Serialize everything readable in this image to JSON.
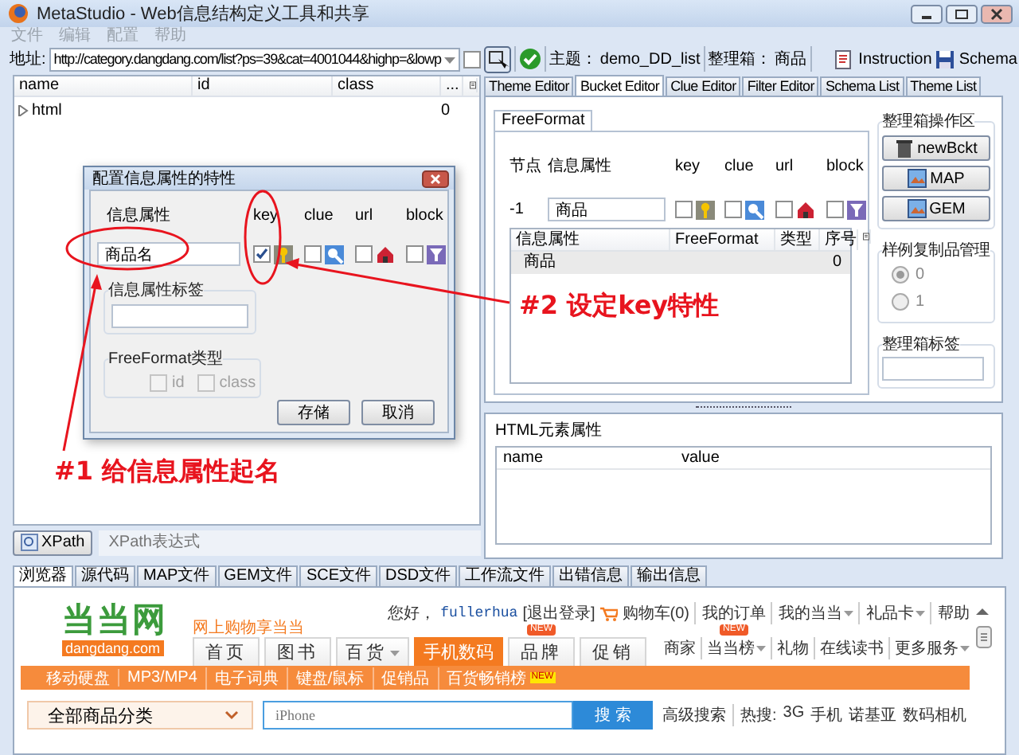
{
  "window": {
    "title": "MetaStudio - Web信息结构定义工具和共享"
  },
  "menu": [
    "文件",
    "编辑",
    "配置",
    "帮助"
  ],
  "toolbar": {
    "address_label": "地址:",
    "url": "http://category.dangdang.com/list?ps=39&cat=4001044&highp=&lowp",
    "checked": false,
    "theme_label": "主题：",
    "theme": "demo_DD_list",
    "bucket_label": "整理箱：",
    "bucket": "商品",
    "buttons": [
      "Instruction",
      "Schema"
    ]
  },
  "dom_tree": {
    "columns": [
      "name",
      "id",
      "class",
      "..."
    ],
    "rows": [
      {
        "name": "html",
        "value": "0",
        "expanded": false
      }
    ]
  },
  "xpath": {
    "button": "XPath",
    "placeholder": "XPath表达式"
  },
  "dialog": {
    "title": "配置信息属性的特性",
    "headers": [
      "信息属性",
      "key",
      "clue",
      "url",
      "block"
    ],
    "attribute": "商品名",
    "flags": [
      {
        "kind": "key",
        "checked": true
      },
      {
        "kind": "clue",
        "checked": false
      },
      {
        "kind": "url",
        "checked": false
      },
      {
        "kind": "block",
        "checked": false
      }
    ],
    "label_group": {
      "title": "信息属性标签"
    },
    "freeformat_group": {
      "title": "FreeFormat类型",
      "disabled": true,
      "options": [
        {
          "label": "id",
          "checked": false
        },
        {
          "label": "class",
          "checked": false
        }
      ]
    },
    "buttons": [
      "存储",
      "取消"
    ]
  },
  "editor_tabs": [
    {
      "label": "Theme Editor",
      "selected": false
    },
    {
      "label": "Bucket Editor",
      "selected": true
    },
    {
      "label": "Clue Editor",
      "selected": false
    },
    {
      "label": "Filter Editor",
      "selected": false
    },
    {
      "label": "Schema List",
      "selected": false
    },
    {
      "label": "Theme List",
      "selected": false
    }
  ],
  "bucket_editor": {
    "subtab": "FreeFormat",
    "headers": [
      "节点",
      "信息属性",
      "key",
      "clue",
      "url",
      "block"
    ],
    "node": "-1",
    "attribute": "商品",
    "flags": [
      {
        "kind": "key",
        "checked": false
      },
      {
        "kind": "clue",
        "checked": false
      },
      {
        "kind": "url",
        "checked": false
      },
      {
        "kind": "block",
        "checked": false
      }
    ],
    "table": {
      "columns": [
        "信息属性",
        "FreeFormat",
        "类型",
        "序号"
      ],
      "rows": [
        {
          "attribute": "商品",
          "index": "0",
          "selected": true
        }
      ]
    }
  },
  "bucket_ops": {
    "title": "整理箱操作区",
    "buttons": [
      "newBckt",
      "MAP",
      "GEM"
    ]
  },
  "sample_mgmt": {
    "title": "样例复制品管理",
    "options": [
      {
        "label": "0",
        "selected": true
      },
      {
        "label": "1",
        "selected": false
      }
    ]
  },
  "bucket_tag": {
    "title": "整理箱标签"
  },
  "html_attributes": {
    "title": "HTML元素属性",
    "columns": [
      "name",
      "value"
    ]
  },
  "bottom_tabs": [
    {
      "label": "浏览器",
      "selected": true
    },
    {
      "label": "源代码",
      "selected": false
    },
    {
      "label": "MAP文件",
      "selected": false
    },
    {
      "label": "GEM文件",
      "selected": false
    },
    {
      "label": "SCE文件",
      "selected": false
    },
    {
      "label": "DSD文件",
      "selected": false
    },
    {
      "label": "工作流文件",
      "selected": false
    },
    {
      "label": "出错信息",
      "selected": false
    },
    {
      "label": "输出信息",
      "selected": false
    }
  ],
  "web_page": {
    "logo": "当当网",
    "logo_sub": "dangdang.com",
    "slogan": "网上购物享当当",
    "greeting": "您好，",
    "user": "fullerhua",
    "logout": "[退出登录]",
    "cart": "购物车(0)",
    "links": [
      {
        "label": "我的订单",
        "dropdown": false
      },
      {
        "label": "我的当当",
        "dropdown": true
      },
      {
        "label": "礼品卡",
        "dropdown": true
      },
      {
        "label": "帮助",
        "dropdown": false
      }
    ],
    "nav": [
      {
        "label": "首页",
        "selected": false,
        "dropdown": false
      },
      {
        "label": "图书",
        "selected": false,
        "dropdown": false
      },
      {
        "label": "百货",
        "selected": false,
        "dropdown": true
      },
      {
        "label": "手机数码",
        "selected": true,
        "dropdown": false
      },
      {
        "label": "品牌",
        "selected": false,
        "dropdown": false,
        "badge": "NEW"
      },
      {
        "label": "促销",
        "selected": false,
        "dropdown": false
      }
    ],
    "nav_right": [
      {
        "label": "商家",
        "dropdown": false
      },
      {
        "label": "当当榜",
        "dropdown": true,
        "badge": "NEW"
      },
      {
        "label": "礼物",
        "dropdown": false
      },
      {
        "label": "在线读书",
        "dropdown": false
      },
      {
        "label": "更多服务",
        "dropdown": true
      }
    ],
    "subnav": [
      {
        "label": "移动硬盘"
      },
      {
        "label": "MP3/MP4"
      },
      {
        "label": "电子词典"
      },
      {
        "label": "键盘/鼠标"
      },
      {
        "label": "促销品"
      },
      {
        "label": "百货畅销榜",
        "badge": "NEW"
      }
    ],
    "category": "全部商品分类",
    "search_placeholder": "iPhone",
    "search_button": "搜 索",
    "advanced": "高级搜索",
    "hot_label": "热搜:",
    "hot": [
      "3G",
      "手机",
      "诺基亚",
      "数码相机"
    ]
  },
  "annotations": [
    {
      "text": "#1 给信息属性起名"
    },
    {
      "text": "#2 设定key特性"
    }
  ]
}
